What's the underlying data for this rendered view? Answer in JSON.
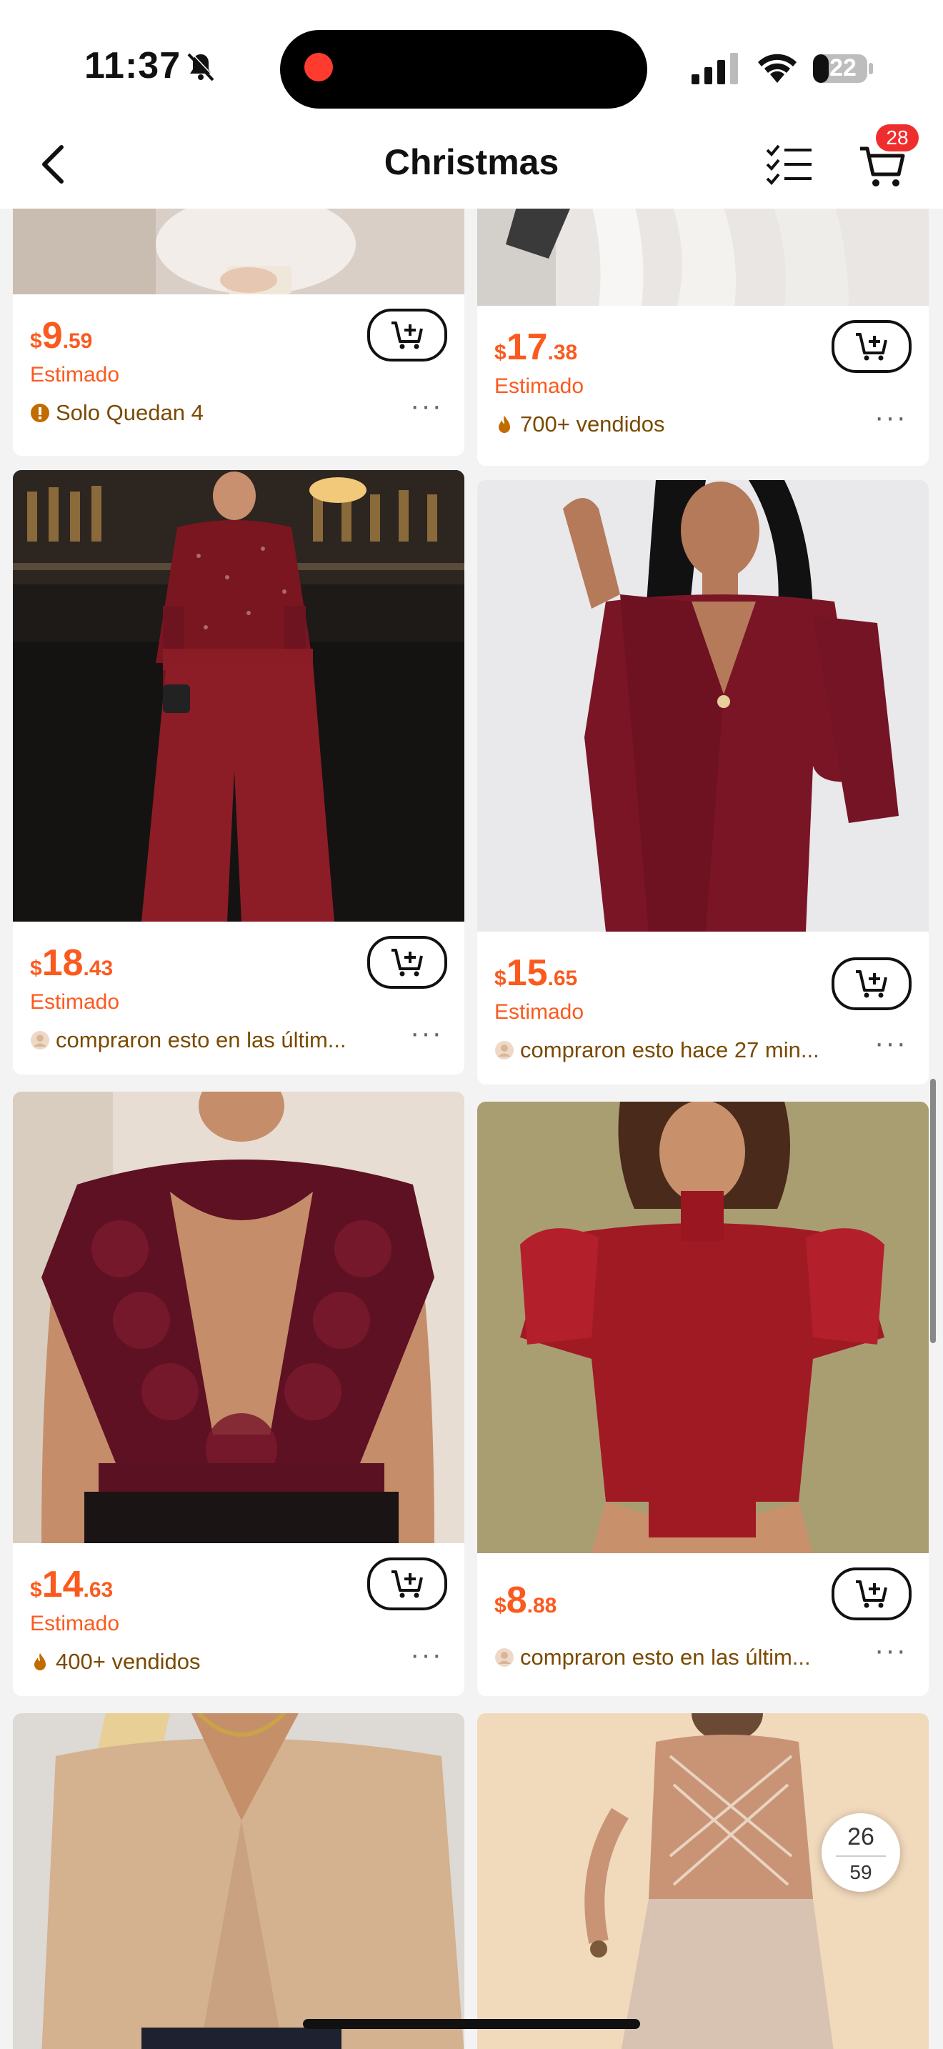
{
  "status_bar": {
    "time": "11:37",
    "battery": "22"
  },
  "header": {
    "title": "Christmas",
    "cart_count": "28"
  },
  "products": [
    {
      "price_currency": "$",
      "price_int": "9",
      "price_dec": ".59",
      "estimate": "Estimado",
      "social": "Solo Quedan  4",
      "social_icon": "warning-icon"
    },
    {
      "price_currency": "$",
      "price_int": "17",
      "price_dec": ".38",
      "estimate": "Estimado",
      "social": "700+ vendidos",
      "social_icon": "flame-icon"
    },
    {
      "price_currency": "$",
      "price_int": "18",
      "price_dec": ".43",
      "estimate": "Estimado",
      "social": "compraron esto en las últim...",
      "social_icon": "user-icon"
    },
    {
      "price_currency": "$",
      "price_int": "15",
      "price_dec": ".65",
      "estimate": "Estimado",
      "social": "compraron esto hace 27 min...",
      "social_icon": "user-icon"
    },
    {
      "price_currency": "$",
      "price_int": "14",
      "price_dec": ".63",
      "estimate": "Estimado",
      "social": "400+ vendidos",
      "social_icon": "flame-icon"
    },
    {
      "price_currency": "$",
      "price_int": "8",
      "price_dec": ".88",
      "estimate": "",
      "social": "compraron esto en las últim...",
      "social_icon": "user-icon"
    }
  ],
  "pager": {
    "current": "26",
    "total": "59"
  },
  "colors": {
    "accent": "#fb5a1f",
    "badge": "#f02d2d",
    "social_text": "#7a4a00"
  }
}
